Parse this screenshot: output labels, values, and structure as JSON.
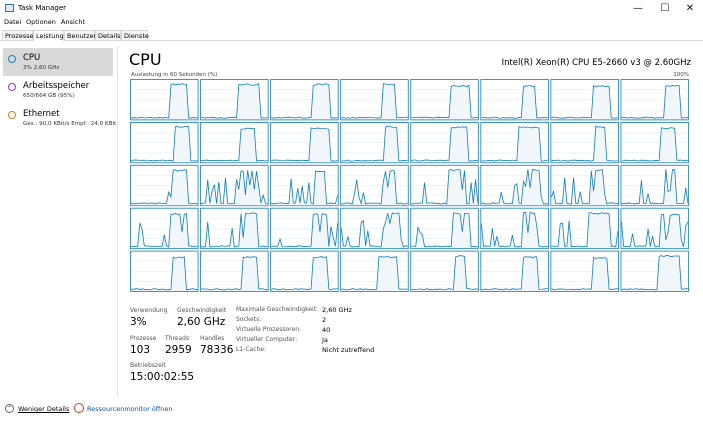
{
  "window": {
    "title": "Task Manager",
    "controls": {
      "minimize": "—",
      "maximize": "☐",
      "close": "✕"
    }
  },
  "menu": [
    "Datei",
    "Optionen",
    "Ansicht"
  ],
  "tabs": [
    {
      "label": "Prozesse",
      "active": false
    },
    {
      "label": "Leistung",
      "active": true
    },
    {
      "label": "Benutzer",
      "active": false
    },
    {
      "label": "Details",
      "active": false
    },
    {
      "label": "Dienste",
      "active": false
    }
  ],
  "sidebar": {
    "items": [
      {
        "name": "CPU",
        "sub": "3% 2,60 GHz",
        "color": "#1f7fbf",
        "selected": true
      },
      {
        "name": "Arbeitsspeicher",
        "sub": "650/664 GB (95%)",
        "color": "#8b3fb2",
        "selected": false
      },
      {
        "name": "Ethernet",
        "sub": "Ges.: 90,0 KBit/s Empf.: 24,0 KBit",
        "color": "#d97c1e",
        "selected": false
      }
    ]
  },
  "cpu": {
    "title": "CPU",
    "model": "Intel(R) Xeon(R) CPU E5-2660 v3 @ 2.60GHz",
    "graph_label": "Auslastung in 60 Sekunden (%)",
    "graph_max": "100%",
    "graph_rows": 5,
    "graph_cols": 8,
    "line_color": "#117dbb",
    "fill_color": "#f1f6fa",
    "grid_color": "#d9eaf4"
  },
  "stats": {
    "usage_label": "Verwendung",
    "usage": "3%",
    "speed_label": "Geschwindigkeit",
    "speed": "2,60 GHz",
    "processes_label": "Prozesse",
    "processes": "103",
    "threads_label": "Threads",
    "threads": "2959",
    "handles_label": "Handles",
    "handles": "78336",
    "uptime_label": "Betriebszeit",
    "uptime": "15:00:02:55"
  },
  "details": [
    {
      "key": "Maximale Geschwindigkeit:",
      "value": "2,60 GHz"
    },
    {
      "key": "Sockets:",
      "value": "2"
    },
    {
      "key": "Virtuelle Prozessoren:",
      "value": "40"
    },
    {
      "key": "Virtueller Computer:",
      "value": "Ja"
    },
    {
      "key": "L1-Cache:",
      "value": "Nicht zutreffend"
    }
  ],
  "footer": {
    "less_details": "Weniger Details",
    "resource_monitor": "Ressourcenmonitor öffnen"
  }
}
